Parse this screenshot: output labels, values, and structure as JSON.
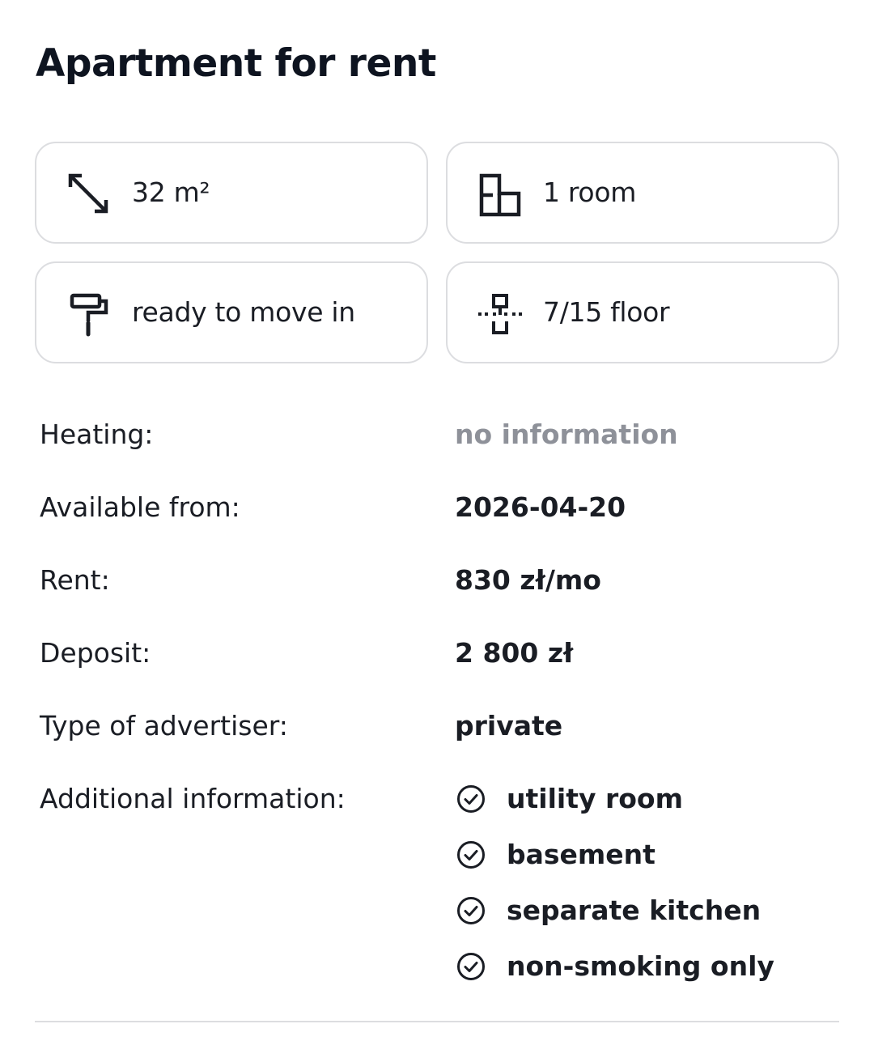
{
  "title": "Apartment for rent",
  "tiles": {
    "area": {
      "icon": "resize-arrows-icon",
      "text": "32 m²"
    },
    "rooms": {
      "icon": "floor-plan-icon",
      "text": "1 room"
    },
    "condition": {
      "icon": "paint-roller-icon",
      "text": "ready to move in"
    },
    "floor": {
      "icon": "floor-level-icon",
      "text": "7/15 floor"
    }
  },
  "details": [
    {
      "label": "Heating:",
      "value": "no information"
    },
    {
      "label": "Available from:",
      "value": "2026-04-20"
    },
    {
      "label": "Rent:",
      "value": "830 zł/mo"
    },
    {
      "label": "Deposit:",
      "value": "2 800 zł"
    },
    {
      "label": "Type of advertiser:",
      "value": "private"
    }
  ],
  "additional": {
    "label": "Additional information:",
    "icon": "check-circle-icon",
    "items": [
      "utility room",
      "basement",
      "separate kitchen",
      "non-smoking only"
    ]
  },
  "colors": {
    "text": "#1a1d24",
    "muted": "#8e9199",
    "border": "#dcdde0"
  }
}
